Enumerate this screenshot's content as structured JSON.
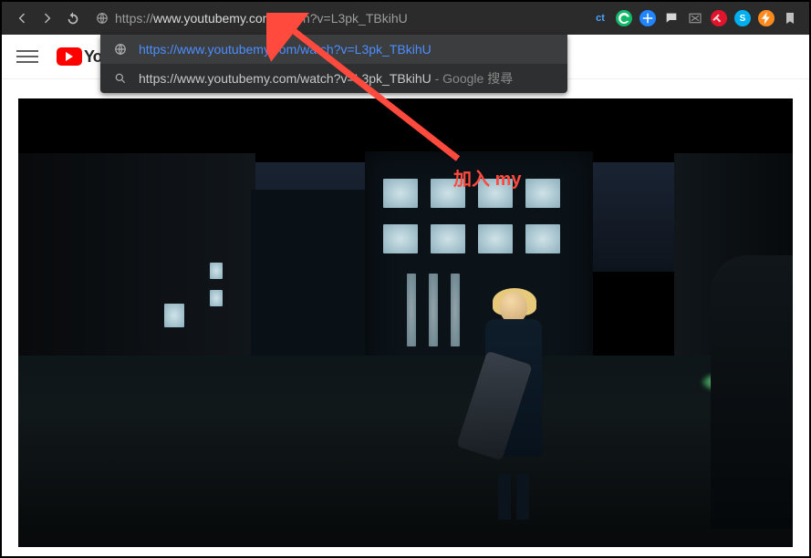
{
  "browser": {
    "address": {
      "scheme": "https://",
      "bold": "www.youtubemy.com",
      "rest": "/watch?v=L3pk_TBkihU"
    }
  },
  "omnibox": {
    "suggestion1": "https://www.youtubemy.com/watch?v=L3pk_TBkihU",
    "suggestion2": "https://www.youtubemy.com/watch?v=L3pk_TBkihU",
    "suffix": " - Google 搜尋"
  },
  "youtube": {
    "logo_text": "YouTube"
  },
  "ext": {
    "ct": "ct",
    "s": "S"
  },
  "annotation": {
    "prefix": "加入 ",
    "highlight": "my"
  }
}
